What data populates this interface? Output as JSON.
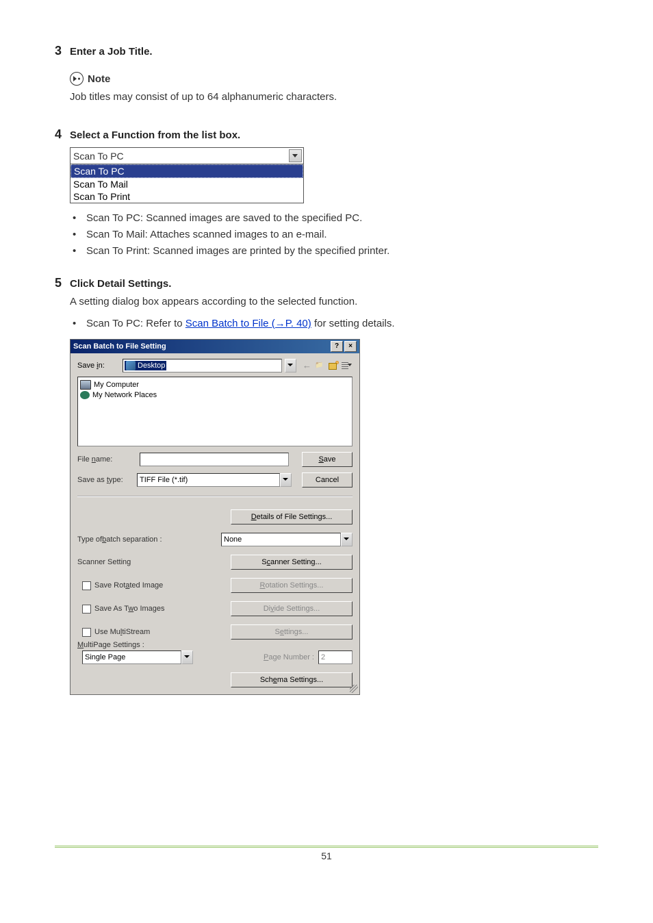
{
  "steps": {
    "s3": {
      "num": "3",
      "title": "Enter a Job Title."
    },
    "s4": {
      "num": "4",
      "title": "Select a Function from the list box."
    },
    "s5": {
      "num": "5",
      "title": "Click Detail Settings."
    }
  },
  "note": {
    "label": "Note",
    "text": "Job titles may consist of up to 64 alphanumeric characters."
  },
  "dropdown": {
    "selected": "Scan To PC",
    "options": [
      "Scan To PC",
      "Scan To Mail",
      "Scan To Print"
    ]
  },
  "bullets_s4": [
    "Scan To PC: Scanned images are saved to the specified PC.",
    "Scan To Mail: Attaches scanned images to an e-mail.",
    "Scan To Print: Scanned images are printed by the specified printer."
  ],
  "s5_body": "A setting dialog box appears according to the selected function.",
  "s5_bullet": {
    "prefix": "Scan To PC: Refer to ",
    "link": "Scan Batch to File  (→P. 40)",
    "suffix": "  for setting details."
  },
  "dialog": {
    "title": "Scan Batch to File Setting",
    "help_btn": "?",
    "close_btn": "×",
    "save_in_label": "Save in:",
    "save_in_value": "Desktop",
    "filepane": [
      "My Computer",
      "My Network Places"
    ],
    "file_name_label": "File name:",
    "file_name_value": "",
    "save_btn": "Save",
    "save_type_label": "Save as type:",
    "save_type_value": "TIFF File (*.tif)",
    "cancel_btn": "Cancel",
    "details_btn": "Details of File Settings...",
    "batch_label": "Type of batch separation :",
    "batch_value": "None",
    "scanner_setting_label": "Scanner Setting",
    "scanner_setting_btn": "Scanner Setting...",
    "rotated_label": "Save Rotated Image",
    "rotation_btn": "Rotation Settings...",
    "twoimg_label": "Save As Two Images",
    "divide_btn": "Divide Settings...",
    "multistream_label": "Use MultiStream",
    "settings_btn": "Settings...",
    "multipage_label": "MultiPage Settings :",
    "multipage_value": "Single Page",
    "pagenum_label": "Page Number :",
    "pagenum_value": "2",
    "schema_btn": "Schema Settings..."
  },
  "page_number": "51"
}
